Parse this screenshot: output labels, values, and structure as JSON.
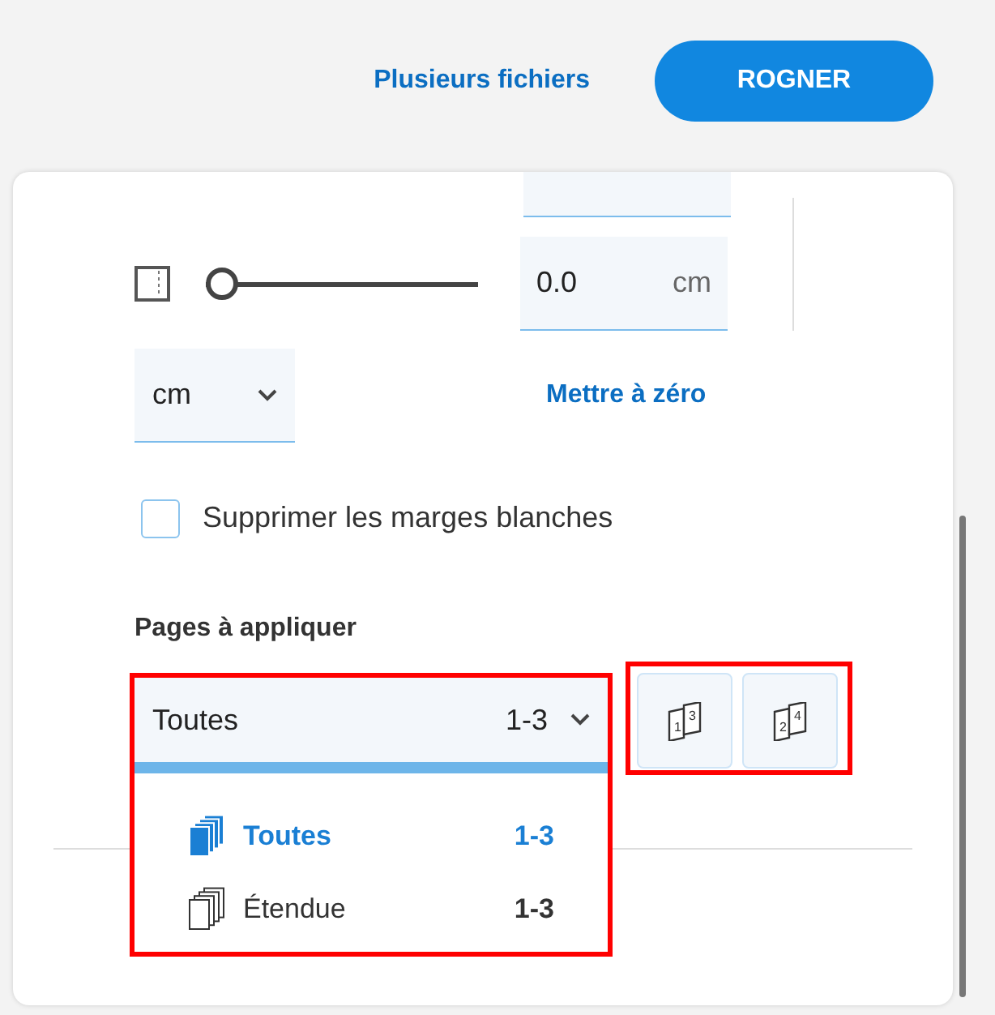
{
  "header": {
    "link": "Plusieurs fichiers",
    "button": "ROGNER"
  },
  "margin": {
    "slider": {
      "level": 0
    },
    "value": "0.0",
    "unit": "cm"
  },
  "unit_select": {
    "value": "cm"
  },
  "reset_link": "Mettre à zéro",
  "remove_white_margins": {
    "label": "Supprimer les marges blanches",
    "checked": false
  },
  "pages": {
    "label": "Pages à appliquer",
    "select": {
      "value": "Toutes",
      "range": "1-3",
      "expanded": true
    },
    "options": [
      {
        "label": "Toutes",
        "range": "1-3",
        "selected": true
      },
      {
        "label": "Étendue",
        "range": "1-3",
        "selected": false
      }
    ],
    "page_buttons": [
      {
        "digits": [
          "1",
          "3"
        ]
      },
      {
        "digits": [
          "2",
          "4"
        ]
      }
    ]
  }
}
